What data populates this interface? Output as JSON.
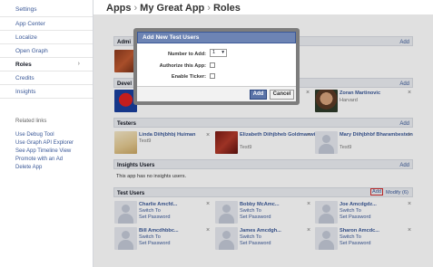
{
  "sidebar": {
    "items": [
      {
        "label": "Settings"
      },
      {
        "label": "App Center"
      },
      {
        "label": "Localize"
      },
      {
        "label": "Open Graph"
      },
      {
        "label": "Roles"
      },
      {
        "label": "Credits"
      },
      {
        "label": "Insights"
      }
    ],
    "related_title": "Related links",
    "related": [
      {
        "label": "Use Debug Tool"
      },
      {
        "label": "Use Graph API Explorer"
      },
      {
        "label": "See App Timeline View"
      },
      {
        "label": "Promote with an Ad"
      },
      {
        "label": "Delete App"
      }
    ]
  },
  "breadcrumb": {
    "apps": "Apps",
    "sep": "›",
    "app": "My Great App",
    "sep2": "›",
    "page": "Roles"
  },
  "sections": {
    "admins": {
      "title": "Admi",
      "add": "Add"
    },
    "developers": {
      "title": "Devel",
      "add": "Add"
    },
    "testers": {
      "title": "Testers",
      "add": "Add"
    },
    "insights_users": {
      "title": "Insights Users",
      "add": "Add",
      "empty": "This app has no insights users."
    },
    "test_users": {
      "title": "Test Users",
      "add": "Add",
      "modify": "Modify (6)"
    }
  },
  "developers": [
    {
      "name": "Zoran Martinovic",
      "sub": "Harvard"
    }
  ],
  "testers": [
    {
      "name": "Linda Diihjbhbj Huiman",
      "sub": "Test9"
    },
    {
      "name": "Elizabeth Diihjbheb Goldmanwitz",
      "sub": "Test9"
    },
    {
      "name": "Mary Diihjbhbf Bharambestein",
      "sub": "Test9"
    }
  ],
  "test_users": [
    {
      "name": "Charlie Amcfd...",
      "link1": "Switch To",
      "link2": "Set Password"
    },
    {
      "name": "Bobby McAmc...",
      "link1": "Switch To",
      "link2": "Set Password"
    },
    {
      "name": "Joe Amcdgdz...",
      "link1": "Switch To",
      "link2": "Set Password"
    },
    {
      "name": "Bill Amcdhbbc...",
      "link1": "Switch To",
      "link2": "Set Password"
    },
    {
      "name": "James Amcdgh...",
      "link1": "Switch To",
      "link2": "Set Password"
    },
    {
      "name": "Sharon Amcdc...",
      "link1": "Switch To",
      "link2": "Set Password"
    }
  ],
  "dialog": {
    "title": "Add New Test Users",
    "number_label": "Number to Add:",
    "number_value": "1",
    "authorize_label": "Authorize this App:",
    "ticker_label": "Enable Ticker:",
    "add_button": "Add",
    "cancel_button": "Cancel"
  },
  "icons": {
    "close": "×",
    "chevron": "›",
    "dropdown": "▾"
  },
  "colors": {
    "link": "#3b5998",
    "dialog_header": "#6d84b4",
    "highlight": "#d12d2d"
  }
}
